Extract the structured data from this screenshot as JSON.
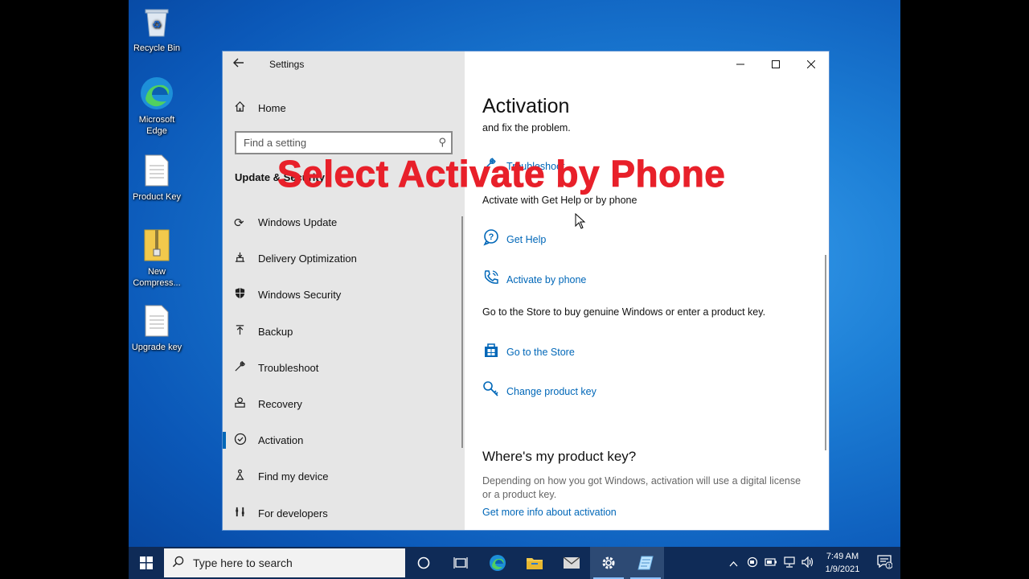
{
  "desktop": {
    "icons": [
      {
        "label": "Recycle Bin",
        "icon": "recycle-bin-icon"
      },
      {
        "label": "Microsoft Edge",
        "icon": "edge-icon"
      },
      {
        "label": "Product Key",
        "icon": "text-file-icon"
      },
      {
        "label": "New Compress...",
        "icon": "zip-folder-icon"
      },
      {
        "label": "Upgrade  key",
        "icon": "text-file-icon"
      }
    ]
  },
  "window": {
    "title": "Settings",
    "nav": {
      "home": "Home",
      "search_placeholder": "Find a setting",
      "section": "Update & Security",
      "items": [
        {
          "label": "Windows Update",
          "icon": "sync-icon"
        },
        {
          "label": "Delivery Optimization",
          "icon": "delivery-icon"
        },
        {
          "label": "Windows Security",
          "icon": "shield-icon"
        },
        {
          "label": "Backup",
          "icon": "backup-arrow-icon"
        },
        {
          "label": "Troubleshoot",
          "icon": "wrench-icon"
        },
        {
          "label": "Recovery",
          "icon": "recovery-icon"
        },
        {
          "label": "Activation",
          "icon": "check-circle-icon",
          "active": true
        },
        {
          "label": "Find my device",
          "icon": "person-locate-icon"
        },
        {
          "label": "For developers",
          "icon": "developer-tools-icon"
        }
      ]
    },
    "content": {
      "title": "Activation",
      "fix_text": "and fix the problem.",
      "troubleshoot_link": "Troubleshoot",
      "get_help_heading": "Activate with Get Help or by phone",
      "get_help_link": "Get Help",
      "phone_link": "Activate by phone",
      "store_text": "Go to the Store to buy genuine Windows or enter a product key.",
      "store_link": "Go to the Store",
      "change_key_link": "Change product key",
      "product_key_heading": "Where's my product key?",
      "product_key_desc": "Depending on how you got Windows, activation will use a digital license or a product key.",
      "more_info_link": "Get more info about activation"
    }
  },
  "overlay_caption": "Select Activate  by Phone",
  "taskbar": {
    "search_placeholder": "Type here to search",
    "apps": [
      "cortana-icon",
      "task-view-icon",
      "edge-icon",
      "file-explorer-icon",
      "mail-icon",
      "settings-gear-icon",
      "notepad-icon"
    ],
    "time": "7:49 AM",
    "date": "1/9/2021",
    "notification_count": "1"
  },
  "colors": {
    "accent": "#0067b8",
    "caption": "#e8202a",
    "taskbar": "#0f2b57"
  }
}
